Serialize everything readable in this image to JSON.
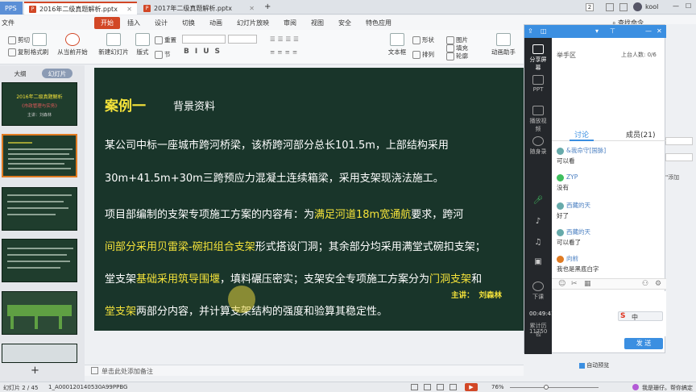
{
  "titlebar": {
    "app": "PPS",
    "tabs": [
      "2016年二级真题解析.pptx",
      "2017年二级真题解析.pptx"
    ],
    "add_tab": "+",
    "user": "kool",
    "right_badge": "2"
  },
  "menubar": {
    "file": "文件",
    "items": [
      "开始",
      "插入",
      "设计",
      "切换",
      "动画",
      "幻灯片放映",
      "审阅",
      "视图",
      "安全",
      "特色应用"
    ],
    "right": "查找命令"
  },
  "ribbon": {
    "cut": "剪切",
    "copy": "复制",
    "format_painter": "格式刷",
    "play_from_current": "从当前开始",
    "new_slide": "新建幻灯片",
    "layout": "版式",
    "section": "节",
    "reset": "重置",
    "textbox": "文本框",
    "shape": "形状",
    "arrange": "排列",
    "picture": "图片",
    "fill": "填充",
    "outline": "轮廓",
    "animation_helper": "动画助手"
  },
  "leftpanel": {
    "tab_outline": "大纲",
    "tab_slides": "幻灯片",
    "slide1_title": "2016年二级真题解析",
    "slide1_sub": "《市政管理与实务》",
    "slide1_speaker": "主讲：刘森林",
    "numbers": [
      "1",
      "2",
      "3",
      "4",
      "5",
      "6"
    ],
    "add": "+"
  },
  "slide": {
    "case_title": "案例一",
    "subtitle": "背景资料",
    "p1": "某公司中标一座城市跨河桥梁，该桥跨河部分总长101.5m，上部结构采用",
    "p2": "30m+41.5m+30m三跨预应力混凝土连续箱梁，采用支架现浇法施工。",
    "p3a": "项目部编制的支架专项施工方案的内容有：为",
    "p3b": "满足河道18m宽通航",
    "p3c": "要求，跨河",
    "p4a": "间部分采用贝雷梁-碗扣组合支架",
    "p4b": "形式搭设门洞；其余部分均采用满堂式碗扣支架；",
    "p5a": "堂支架",
    "p5b": "基础采用筑导围堰",
    "p5c": "，填料碾压密实；支架安全专项施工方案分为",
    "p5d": "门洞支架",
    "p5e": "和",
    "p6a": "堂支架",
    "p6b": "两部分内容，并计算支架结构的强度和验算其稳定性。",
    "speaker_label": "主讲：",
    "speaker_name": "刘森林"
  },
  "notes": {
    "placeholder": "单击此处添加备注"
  },
  "statusbar": {
    "slide_info": "幻灯片 2 / 45",
    "template": "1_A000120140530A99PPBG",
    "zoom": "76%",
    "right_text": "我是珊仔。帮你搞定"
  },
  "rightpanel": {
    "share_screen": "分享屏幕",
    "ppt": "PPT",
    "play_video": "播放视频",
    "record": "随身录",
    "raise_hand_area": "举手区",
    "on_stage": "上台人数: 0/6",
    "tab_discuss": "讨论",
    "tab_members": "成员(21)",
    "end_class": "下课",
    "timer": "00:49:41",
    "cumulative_label": "累计历包",
    "cumulative_value": "11750",
    "messages": [
      {
        "name": "&我命守[国脉]",
        "text": "可以看"
      },
      {
        "name": "ZYP",
        "text": "没有"
      },
      {
        "name": "西藏的天",
        "text": "好了"
      },
      {
        "name": "西藏的天",
        "text": "可以看了"
      },
      {
        "name": "向前",
        "text": "我也是黑底白字"
      }
    ],
    "send": "发 送",
    "ime": "中"
  },
  "farright": {
    "text1": "\"添加",
    "auto_preview": "自动预览"
  },
  "colors": {
    "accent": "#d24726",
    "slide_bg": "#19352a",
    "highlight": "#f4e23a",
    "chat_blue": "#3b8fe1"
  }
}
